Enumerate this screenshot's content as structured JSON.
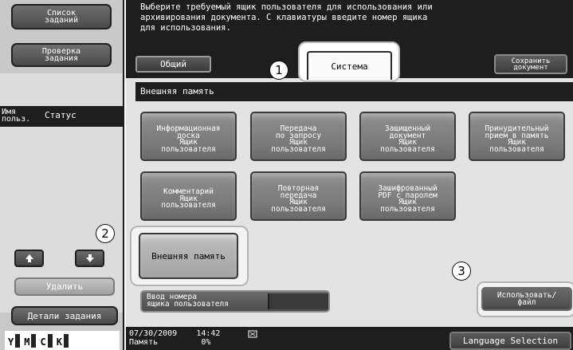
{
  "left_panel": {
    "job_list_label": "Список\nзаданий",
    "check_job_label": "Проверка\nзадания",
    "col_user": "Имя\nпольз.",
    "col_status": "Статус",
    "up_icon": "arrow-up-icon",
    "down_icon": "arrow-down-icon",
    "delete_label": "Удалить",
    "job_details_label": "Детали задания",
    "toner": [
      {
        "letter": "Y"
      },
      {
        "letter": "M"
      },
      {
        "letter": "C"
      },
      {
        "letter": "K"
      }
    ]
  },
  "message": {
    "lines": [
      "Выберите требуемый ящик пользователя для использования или",
      "архивирования документа. С клавиатуры введите номер ящика",
      "для использования."
    ]
  },
  "tabs": {
    "general": "Общий",
    "system": "Система",
    "save_document": "Сохранить\nдокумент"
  },
  "callouts": [
    "1",
    "2",
    "3"
  ],
  "section_title": "Внешняя память",
  "boxes": [
    "Информационная\nдоска\nЯщик\nпользователя",
    "Передача\nпо запросу\nЯщик\nпользователя",
    "Защищенный\nдокумент\nЯщик\nпользователя",
    "Принудительный\nприем в память\nЯщик\nпользователя",
    "Комментарий\nЯщик\nпользователя",
    "Повторная\nпередача\nЯщик\nпользователя",
    "Зашифрованный\nPDF с паролем\nЯщик\nпользователя"
  ],
  "external_memory_button": "Внешняя память",
  "user_box_input_label": "Ввод номера\nящика пользователя",
  "use_file_button": "Использовать/\nфайл",
  "status_bar": {
    "date": "07/30/2009",
    "time": "14:42",
    "memory_label": "Память",
    "memory_value": "0%",
    "network_icon": "network-status-icon",
    "language_button": "Language Selection"
  },
  "colors": {
    "dark_bar": "#1e1e1e",
    "panel_gray": "#c9c9c9",
    "button_gray": "#7c7c7c",
    "highlight_ring": "#b4b4b4"
  }
}
